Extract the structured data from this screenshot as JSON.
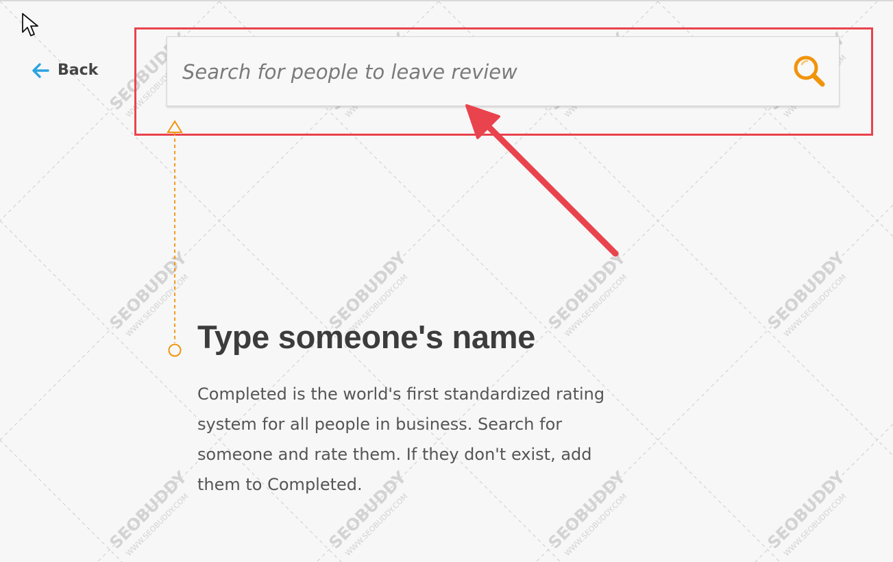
{
  "back": {
    "label": "Back",
    "icon": "arrow-left-icon",
    "icon_color": "#2ba3e0"
  },
  "search": {
    "placeholder": "Search for people to leave review",
    "value": "",
    "icon": "search-icon",
    "icon_color": "#f0940a"
  },
  "intro": {
    "heading": "Type someone's name",
    "description": "Completed is the world's first standardized rating system for all people in business. Search for someone and rate them. If they don't exist, add them to Completed."
  },
  "annotation": {
    "highlight_color": "#e9434d",
    "guide_color": "#f0940a"
  },
  "watermark": {
    "brand": "SEOBUDDY",
    "url": "WWW.SEOBUDDY.COM"
  }
}
